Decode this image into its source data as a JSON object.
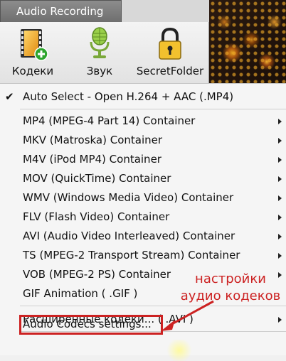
{
  "tab": {
    "label": "Audio Recording"
  },
  "toolbar": {
    "codecs_label": "Кодеки",
    "sound_label": "Звук",
    "secret_label": "SecretFolder"
  },
  "menu": {
    "items": [
      {
        "label": "Auto Select - Open H.264 + AAC (.MP4)",
        "checked": true,
        "submenu": false
      },
      {
        "label": "MP4 (MPEG-4 Part 14) Container",
        "submenu": true
      },
      {
        "label": "MKV (Matroska) Container",
        "submenu": true
      },
      {
        "label": "M4V (iPod MP4) Container",
        "submenu": true
      },
      {
        "label": "MOV (QuickTime) Container",
        "submenu": true
      },
      {
        "label": "WMV (Windows Media Video) Container",
        "submenu": true
      },
      {
        "label": "FLV (Flash Video) Container",
        "submenu": true
      },
      {
        "label": "AVI (Audio Video Interleaved) Container",
        "submenu": true
      },
      {
        "label": "TS (MPEG-2 Transport Stream) Container",
        "submenu": true
      },
      {
        "label": "VOB (MPEG-2 PS) Container",
        "submenu": true
      },
      {
        "label": "GIF Animation ( .GIF )",
        "submenu": false
      },
      {
        "label": "Расширенные кодеки... ( .AVI )",
        "submenu": true
      },
      {
        "label": "Audio Codecs settings...",
        "submenu": false
      }
    ]
  },
  "annotation": {
    "line1": "настройки",
    "line2": "аудио кодеков",
    "color": "#cc2222"
  },
  "check_glyph": "✔"
}
